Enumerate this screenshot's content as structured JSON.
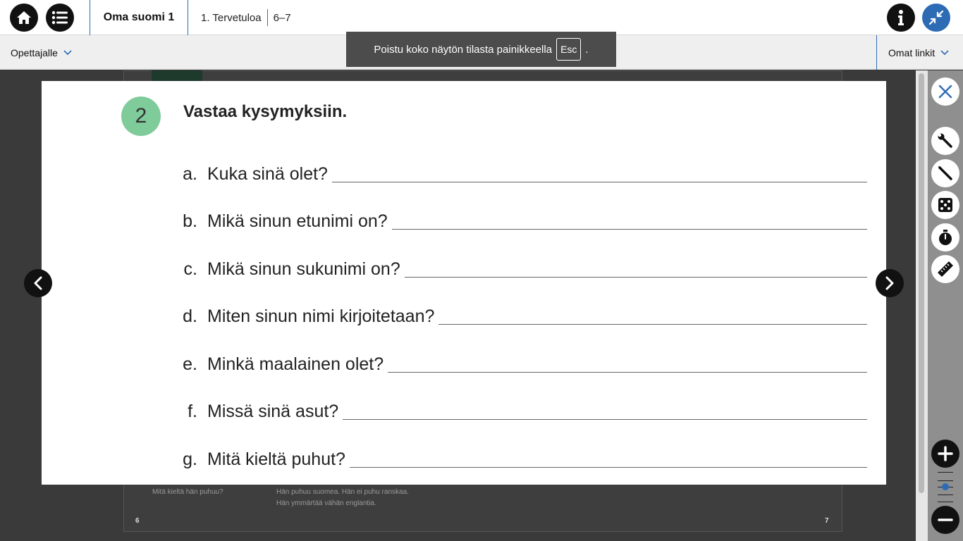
{
  "header": {
    "book_title": "Oma suomi 1",
    "chapter": "1. Tervetuloa",
    "pages": "6–7",
    "icons": {
      "home": "home-icon",
      "menu": "list-icon",
      "info": "info-icon",
      "exit_fullscreen": "compress-icon"
    }
  },
  "subbar": {
    "teacher_label": "Opettajalle",
    "links_label": "Omat linkit"
  },
  "toast": {
    "text_before": "Poistu koko näytön tilasta painikkeella",
    "key": "Esc",
    "text_after": "."
  },
  "background_page": {
    "left_text": "Mitä kieltä hän puhuu?",
    "right_text_1": "Hän puhuu suomea. Hän ei puhu ranskaa.",
    "right_text_2": "Hän ymmärtää vähän englantia.",
    "page_left": "6",
    "page_right": "7"
  },
  "task": {
    "number": "2",
    "title": "Vastaa kysymyksiin.",
    "questions": [
      {
        "letter": "a.",
        "text": "Kuka sinä olet?"
      },
      {
        "letter": "b.",
        "text": "Mikä sinun etunimi on?"
      },
      {
        "letter": "c.",
        "text": "Mikä sinun sukunimi on?"
      },
      {
        "letter": "d.",
        "text": "Miten sinun nimi kirjoitetaan?"
      },
      {
        "letter": "e.",
        "text": "Minkä maalainen olet?"
      },
      {
        "letter": "f.",
        "text": "Missä sinä asut?"
      },
      {
        "letter": "g.",
        "text": "Mitä kieltä puhut?"
      }
    ]
  },
  "tools": [
    "close-icon",
    "wrench-icon",
    "pen-icon",
    "dice-icon",
    "stopwatch-icon",
    "ruler-icon"
  ],
  "colors": {
    "accent": "#2d6bb5",
    "task_circle": "#7fcb9a",
    "toast_bg": "#4c4c4c"
  }
}
